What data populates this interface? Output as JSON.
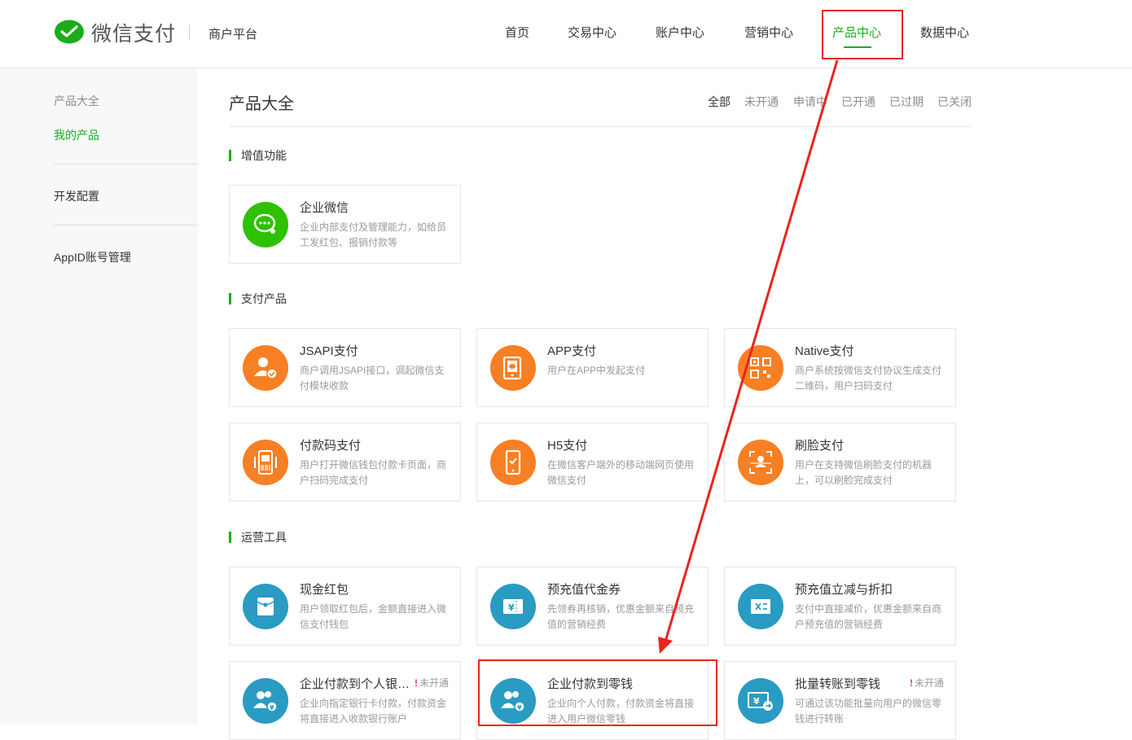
{
  "header": {
    "logo_text": "微信支付",
    "sub_title": "商户平台",
    "nav": [
      "首页",
      "交易中心",
      "账户中心",
      "营销中心",
      "产品中心",
      "数据中心"
    ]
  },
  "sidebar": {
    "title": "产品大全",
    "items": [
      "我的产品",
      "开发配置",
      "AppID账号管理"
    ]
  },
  "main": {
    "title": "产品大全",
    "filters": [
      "全部",
      "未开通",
      "申请中",
      "已开通",
      "已过期",
      "已关闭"
    ]
  },
  "sections": [
    {
      "title": "增值功能",
      "cards": [
        {
          "name": "企业微信",
          "desc": "企业内部支付及管理能力，如给员工发红包、报销付款等",
          "icon": "wework-icon",
          "color": "#2dc100"
        }
      ]
    },
    {
      "title": "支付产品",
      "cards": [
        {
          "name": "JSAPI支付",
          "desc": "商户调用JSAPI接口，调起微信支付模块收款",
          "icon": "user-check-icon",
          "color": "#f77f24"
        },
        {
          "name": "APP支付",
          "desc": "用户在APP中发起支付",
          "icon": "app-phone-icon",
          "color": "#f77f24"
        },
        {
          "name": "Native支付",
          "desc": "商户系统按微信支付协议生成支付二维码，用户扫码支付",
          "icon": "qrcode-icon",
          "color": "#f77f24"
        },
        {
          "name": "付款码支付",
          "desc": "用户打开微信钱包付款卡页面，商户扫码完成支付",
          "icon": "barcode-icon",
          "color": "#f77f24"
        },
        {
          "name": "H5支付",
          "desc": "在微信客户端外的移动端网页使用微信支付",
          "icon": "mobile-pay-icon",
          "color": "#f77f24"
        },
        {
          "name": "刷脸支付",
          "desc": "用户在支持微信刷脸支付的机器上，可以刷脸完成支付",
          "icon": "face-scan-icon",
          "color": "#f77f24"
        }
      ]
    },
    {
      "title": "运营工具",
      "cards": [
        {
          "name": "现金红包",
          "desc": "用户领取红包后，金额直接进入微信支付钱包",
          "icon": "red-packet-icon",
          "color": "#2a9bc2"
        },
        {
          "name": "预充值代金券",
          "desc": "先领券再核销，优惠金额来自预充值的营销经费",
          "icon": "coupon-icon",
          "color": "#2a9bc2"
        },
        {
          "name": "预充值立减与折扣",
          "desc": "支付中直接减价，优惠金额来自商户预充值的营销经费",
          "icon": "discount-icon",
          "color": "#2a9bc2"
        },
        {
          "name": "企业付款到个人银…",
          "desc": "企业向指定银行卡付款，付款资金将直接进入收款银行账户",
          "icon": "users-pay-icon",
          "color": "#2a9bc2",
          "badge": "未开通"
        },
        {
          "name": "企业付款到零钱",
          "desc": "企业向个人付款，付款资金将直接进入用户微信零钱",
          "icon": "users-pay-icon",
          "color": "#2a9bc2"
        },
        {
          "name": "批量转账到零钱",
          "desc": "可通过该功能批量向用户的微信零钱进行转账",
          "icon": "transfer-icon",
          "color": "#2a9bc2",
          "badge": "未开通"
        }
      ]
    }
  ],
  "badge_mark": "!"
}
